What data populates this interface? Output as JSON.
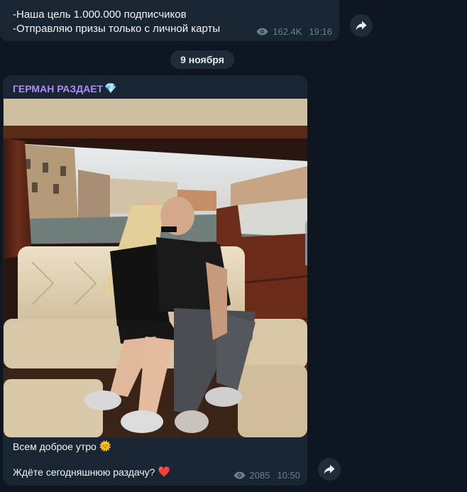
{
  "previous_post": {
    "line1": "-Наша цель 1.000.000 подписчиков",
    "line2": "-Отправляю призы только с личной карты",
    "views": "162.4K",
    "time": "19:16"
  },
  "date_separator": "9 ноября",
  "post": {
    "channel_name": "ГЕРМАН РАЗДАЕТ",
    "channel_emoji": "💎",
    "caption_line1": "Всем доброе утро",
    "caption_line1_emoji": "🌞",
    "caption_line2": "Ждёте сегодняшнюю раздачу?",
    "caption_line2_emoji": "❤️",
    "views": "2085",
    "time": "10:50"
  },
  "colors": {
    "background": "#0e1621",
    "bubble": "#182533",
    "channel_name": "#b28cf5",
    "meta": "#6d7f8f"
  },
  "icons": [
    "eye-icon",
    "share-icon"
  ]
}
